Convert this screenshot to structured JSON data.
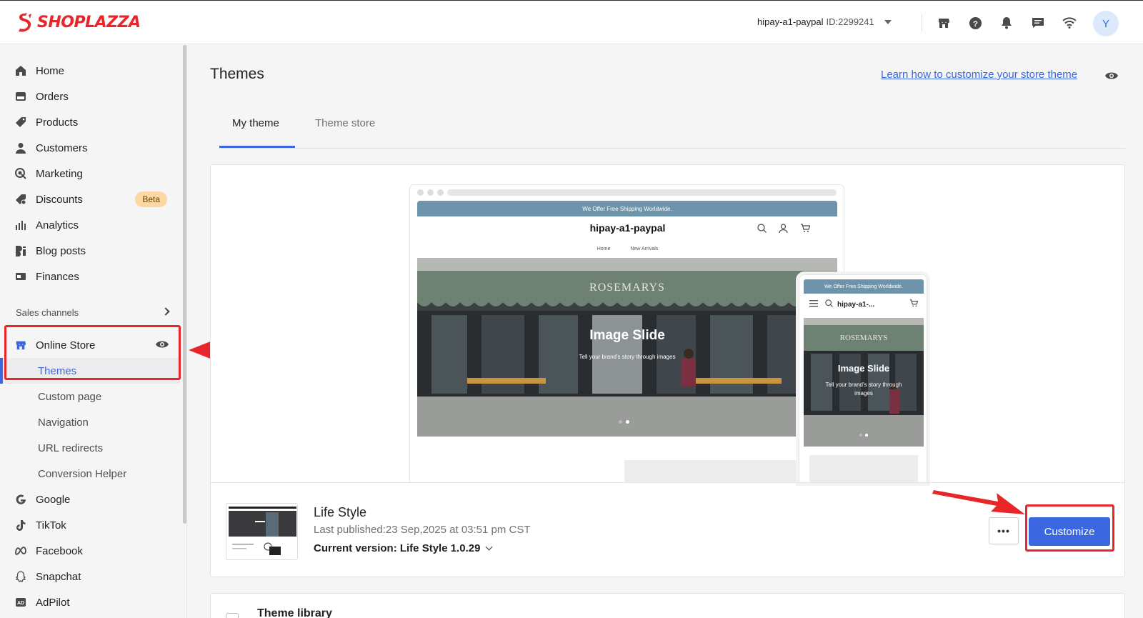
{
  "brand": {
    "logo_text": "SHOPLAZZA",
    "brand_color": "#e8262a",
    "accent_color": "#3b68e0"
  },
  "topbar": {
    "store_name": "hipay-a1-paypal",
    "store_id": "ID:2299241",
    "icons": [
      "store-icon",
      "help-icon",
      "bell-icon",
      "chat-icon",
      "wifi-icon"
    ],
    "avatar_initial": "Y"
  },
  "sidebar": {
    "items": [
      {
        "label": "Home",
        "icon": "home-icon"
      },
      {
        "label": "Orders",
        "icon": "orders-icon"
      },
      {
        "label": "Products",
        "icon": "tag-icon"
      },
      {
        "label": "Customers",
        "icon": "person-icon"
      },
      {
        "label": "Marketing",
        "icon": "marketing-icon"
      },
      {
        "label": "Discounts",
        "icon": "discount-icon",
        "badge": "Beta"
      },
      {
        "label": "Analytics",
        "icon": "analytics-icon"
      },
      {
        "label": "Blog posts",
        "icon": "blog-icon"
      },
      {
        "label": "Finances",
        "icon": "finances-icon"
      }
    ],
    "sales_channels_label": "Sales channels",
    "online_store": {
      "label": "Online Store",
      "icon": "store-icon"
    },
    "online_store_subitems": [
      "Themes",
      "Custom page",
      "Navigation",
      "URL redirects",
      "Conversion Helper"
    ],
    "channels": [
      {
        "label": "Google",
        "icon": "google-icon"
      },
      {
        "label": "TikTok",
        "icon": "tiktok-icon"
      },
      {
        "label": "Facebook",
        "icon": "meta-icon"
      },
      {
        "label": "Snapchat",
        "icon": "snapchat-icon"
      },
      {
        "label": "AdPilot",
        "icon": "adpilot-icon"
      }
    ]
  },
  "main": {
    "title": "Themes",
    "learn_link": "Learn how to customize your store theme",
    "tabs": [
      {
        "label": "My theme",
        "active": true
      },
      {
        "label": "Theme store",
        "active": false
      }
    ],
    "preview": {
      "announcement": "We Offer Free Shipping Worldwide.",
      "store_name": "hipay-a1-paypal",
      "store_name_mobile": "hipay-a1-...",
      "menu": [
        "Home",
        "New Arrivals"
      ],
      "storefront_sign": "ROSEMARYS",
      "hero_title": "Image Slide",
      "hero_subtitle": "Tell your brand's story through images",
      "hero_subtitle_mobile_1": "Tell your brand's story through",
      "hero_subtitle_mobile_2": "images"
    },
    "theme": {
      "name": "Life Style",
      "published": "Last published:23 Sep,2025 at 03:51 pm CST",
      "version": "Current version: Life Style 1.0.29",
      "more_label": "•••",
      "customize_label": "Customize"
    },
    "library_title": "Theme library"
  }
}
